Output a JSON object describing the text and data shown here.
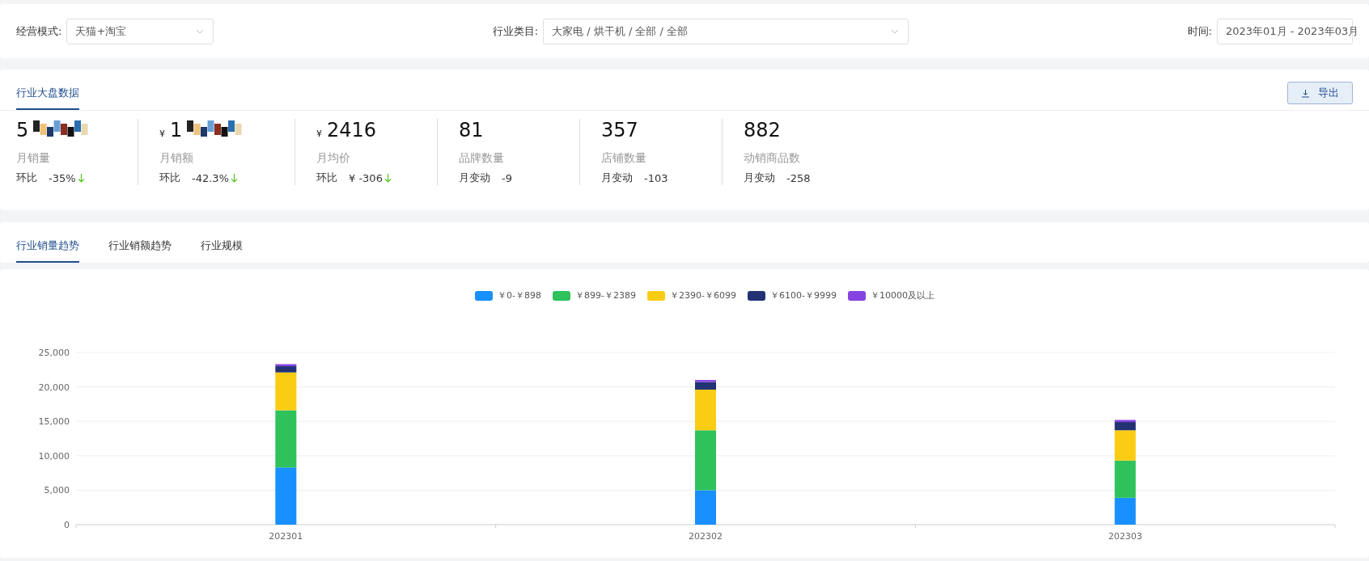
{
  "filters": [
    {
      "label": "经营模式:",
      "value": "天猫+淘宝",
      "kind": "select"
    },
    {
      "label": "行业类目:",
      "value": "大家电 / 烘干机 / 全部 / 全部",
      "kind": "select"
    },
    {
      "label": "时间:",
      "value": "2023年01月 - 2023年03月",
      "kind": "date"
    }
  ],
  "overview": {
    "tabs": [
      {
        "label": "行业大盘数据",
        "selected": true
      }
    ],
    "export_button": "导出",
    "stats": [
      {
        "value": "5",
        "redacted": true,
        "label": "月销量",
        "change_label": "环比",
        "change": "-35%",
        "falling": true
      },
      {
        "prefix": "¥",
        "value": "1",
        "redacted": true,
        "label": "月销额",
        "change_label": "环比",
        "change": "-42.3%",
        "falling": true
      },
      {
        "prefix": "¥",
        "value": "2416",
        "redacted": false,
        "label": "月均价",
        "change_label": "环比",
        "change": "¥ -306",
        "falling": true
      },
      {
        "value": "81",
        "redacted": false,
        "label": "品牌数量",
        "change_label": "月变动",
        "change": "-9",
        "falling": false
      },
      {
        "value": "357",
        "redacted": false,
        "label": "店铺数量",
        "change_label": "月变动",
        "change": "-103",
        "falling": false
      },
      {
        "value": "882",
        "redacted": false,
        "label": "动销商品数",
        "change_label": "月变动",
        "change": "-258",
        "falling": false
      }
    ]
  },
  "trend_tabs": [
    {
      "label": "行业销量趋势",
      "selected": true
    },
    {
      "label": "行业销额趋势",
      "selected": false
    },
    {
      "label": "行业规模",
      "selected": false
    }
  ],
  "chart": {
    "chart_data": {
      "type": "bar",
      "stacked": true,
      "grid": true,
      "categories": [
        "202301",
        "202302",
        "202303"
      ],
      "series": [
        {
          "name": "￥0-￥898",
          "color": "#1890ff",
          "values": [
            8300,
            5000,
            3900
          ]
        },
        {
          "name": "￥899-￥2389",
          "color": "#2fc25b",
          "values": [
            8300,
            8700,
            5400
          ]
        },
        {
          "name": "￥2390-￥6099",
          "color": "#facc14",
          "values": [
            5500,
            5900,
            4400
          ]
        },
        {
          "name": "￥6100-￥9999",
          "color": "#223273",
          "values": [
            900,
            1100,
            1200
          ]
        },
        {
          "name": "￥10000及以上",
          "color": "#8543e0",
          "values": [
            300,
            300,
            300
          ]
        }
      ],
      "ylim": [
        0,
        25000
      ],
      "yticks": [
        {
          "value": 0,
          "label": "0"
        },
        {
          "value": 5000,
          "label": "5,000"
        },
        {
          "value": 10000,
          "label": "10,000"
        },
        {
          "value": 15000,
          "label": "15,000"
        },
        {
          "value": 20000,
          "label": "20,000"
        },
        {
          "value": 25000,
          "label": "25,000"
        }
      ]
    }
  }
}
